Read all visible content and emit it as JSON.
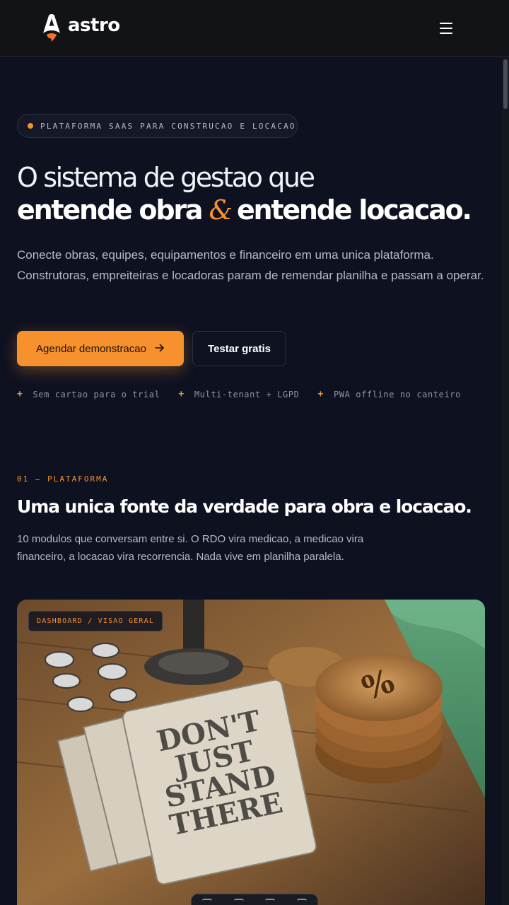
{
  "header": {
    "brand": "astro",
    "logo_icon": "astro-logo-icon",
    "menu_icon": "hamburger-menu-icon"
  },
  "hero": {
    "badge": "PLATAFORMA SAAS PARA CONSTRUCAO E LOCACAO",
    "title_line1": "O sistema de gestao que",
    "title_part1": "entende obra",
    "title_amp": "&",
    "title_part2": "entende locacao",
    "title_period": ".",
    "description": "Conecte obras, equipes, equipamentos e financeiro em uma unica plataforma. Construtoras, empreiteiras e locadoras param de remendar planilha e passam a operar.",
    "primary_cta": "Agendar demonstracao",
    "primary_cta_icon": "arrow-right-icon",
    "secondary_cta": "Testar gratis",
    "features": [
      "Sem cartao para o trial",
      "Multi-tenant + LGPD",
      "PWA offline no canteiro"
    ]
  },
  "platform": {
    "label": "01 — PLATAFORMA",
    "title": "Uma unica fonte da verdade para obra e locacao.",
    "description": "10 modulos que conversam entre si. O RDO vira medicao, a medicao vira financeiro, a locacao vira recorrencia. Nada vive em planilha paralela.",
    "image_badge": "DASHBOARD / VISAO GERAL",
    "image_text_line1": "DON'T",
    "image_text_line2": "JUST",
    "image_text_line3": "STAND",
    "image_text_line4": "THERE"
  },
  "colors": {
    "background": "#0e1120",
    "header": "#121317",
    "accent": "#f7912e"
  }
}
